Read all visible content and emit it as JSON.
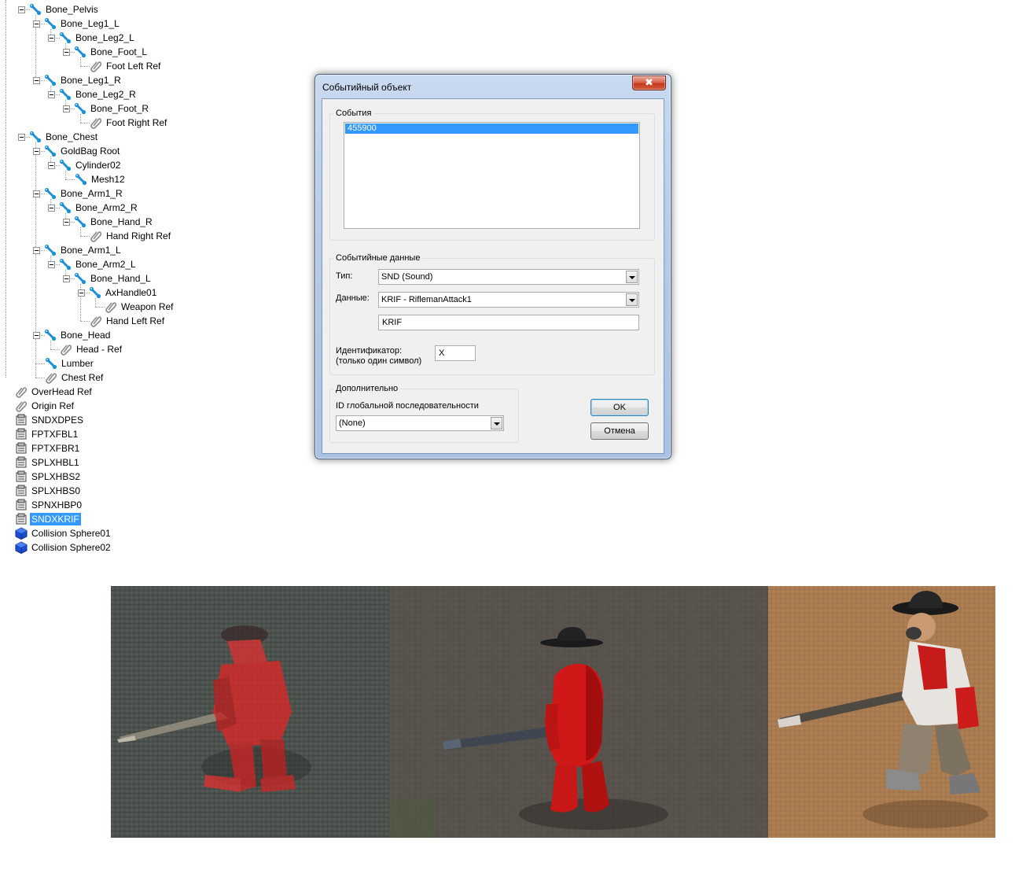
{
  "tree": {
    "nodes": [
      {
        "label": "Bone_Pelvis",
        "icon": "bone-icon",
        "depth": 1,
        "expanded": true
      },
      {
        "label": "Bone_Leg1_L",
        "icon": "bone-icon",
        "depth": 2,
        "expanded": true
      },
      {
        "label": "Bone_Leg2_L",
        "icon": "bone-icon",
        "depth": 3,
        "expanded": true
      },
      {
        "label": "Bone_Foot_L",
        "icon": "bone-icon",
        "depth": 4,
        "expanded": true
      },
      {
        "label": "Foot Left Ref",
        "icon": "attachment-clip-icon",
        "depth": 5
      },
      {
        "label": "Bone_Leg1_R",
        "icon": "bone-icon",
        "depth": 2,
        "expanded": true
      },
      {
        "label": "Bone_Leg2_R",
        "icon": "bone-icon",
        "depth": 3,
        "expanded": true
      },
      {
        "label": "Bone_Foot_R",
        "icon": "bone-icon",
        "depth": 4,
        "expanded": true
      },
      {
        "label": "Foot Right Ref",
        "icon": "attachment-clip-icon",
        "depth": 5
      },
      {
        "label": "Bone_Chest",
        "icon": "bone-icon",
        "depth": 1,
        "expanded": true
      },
      {
        "label": "GoldBag Root",
        "icon": "bone-icon",
        "depth": 2,
        "expanded": true
      },
      {
        "label": "Cylinder02",
        "icon": "bone-icon",
        "depth": 3,
        "expanded": true
      },
      {
        "label": "Mesh12",
        "icon": "bone-icon",
        "depth": 4
      },
      {
        "label": "Bone_Arm1_R",
        "icon": "bone-icon",
        "depth": 2,
        "expanded": true
      },
      {
        "label": "Bone_Arm2_R",
        "icon": "bone-icon",
        "depth": 3,
        "expanded": true
      },
      {
        "label": "Bone_Hand_R",
        "icon": "bone-icon",
        "depth": 4,
        "expanded": true
      },
      {
        "label": "Hand Right Ref",
        "icon": "attachment-clip-icon",
        "depth": 5
      },
      {
        "label": "Bone_Arm1_L",
        "icon": "bone-icon",
        "depth": 2,
        "expanded": true
      },
      {
        "label": "Bone_Arm2_L",
        "icon": "bone-icon",
        "depth": 3,
        "expanded": true
      },
      {
        "label": "Bone_Hand_L",
        "icon": "bone-icon",
        "depth": 4,
        "expanded": true
      },
      {
        "label": "AxHandle01",
        "icon": "bone-icon",
        "depth": 5,
        "expanded": true
      },
      {
        "label": "Weapon Ref",
        "icon": "attachment-clip-icon",
        "depth": 6
      },
      {
        "label": "Hand Left Ref",
        "icon": "attachment-clip-icon",
        "depth": 5
      },
      {
        "label": "Bone_Head",
        "icon": "bone-icon",
        "depth": 2,
        "expanded": true
      },
      {
        "label": "Head - Ref",
        "icon": "attachment-clip-icon",
        "depth": 3
      },
      {
        "label": "Lumber",
        "icon": "bone-icon",
        "depth": 2
      },
      {
        "label": "Chest Ref",
        "icon": "attachment-clip-icon",
        "depth": 2
      },
      {
        "label": "OverHead Ref",
        "icon": "attachment-clip-icon",
        "depth": 0
      },
      {
        "label": "Origin Ref",
        "icon": "attachment-clip-icon",
        "depth": 0
      },
      {
        "label": "SNDXDPES",
        "icon": "event-object-icon",
        "depth": 0
      },
      {
        "label": "FPTXFBL1",
        "icon": "event-object-icon",
        "depth": 0
      },
      {
        "label": "FPTXFBR1",
        "icon": "event-object-icon",
        "depth": 0
      },
      {
        "label": "SPLXHBL1",
        "icon": "event-object-icon",
        "depth": 0
      },
      {
        "label": "SPLXHBS2",
        "icon": "event-object-icon",
        "depth": 0
      },
      {
        "label": "SPLXHBS0",
        "icon": "event-object-icon",
        "depth": 0
      },
      {
        "label": "SPNXHBP0",
        "icon": "event-object-icon",
        "depth": 0
      },
      {
        "label": "SNDXKRIF",
        "icon": "event-object-icon",
        "depth": 0,
        "selected": true
      },
      {
        "label": "Collision Sphere01",
        "icon": "collision-cube-icon",
        "depth": 0
      },
      {
        "label": "Collision Sphere02",
        "icon": "collision-cube-icon",
        "depth": 0
      }
    ]
  },
  "dialog": {
    "title": "Событийный объект",
    "close_glyph": "✖",
    "events_group": {
      "legend": "События",
      "items": [
        {
          "label": "455900",
          "selected": true
        }
      ]
    },
    "event_data_group": {
      "legend": "Событийные данные",
      "type_label": "Тип:",
      "type_value": "SND (Sound)",
      "data_label": "Данные:",
      "data_value": "KRIF - RiflemanAttack1",
      "data_text": "KRIF",
      "identifier_label_line1": "Идентификатор:",
      "identifier_label_line2": "(только один символ)",
      "identifier_value": "X"
    },
    "additional_group": {
      "legend": "Дополнительно",
      "global_seq_label": "ID глобальной последовательности",
      "global_seq_value": "(None)"
    },
    "ok_label": "OK",
    "cancel_label": "Отмена"
  },
  "colors": {
    "selection": "#3399ff",
    "bone_icon": "#1e90d8",
    "collision_icon": "#1b4fd1",
    "dialog_frame": "#b5cbe8",
    "close_button": "#c7361b"
  },
  "viewports": [
    {
      "name": "translucent-red-model-view",
      "ground": "#4b524a"
    },
    {
      "name": "solid-red-model-view",
      "ground": "#56524b"
    },
    {
      "name": "textured-rifleman-view",
      "ground": "#a87a4f"
    }
  ]
}
